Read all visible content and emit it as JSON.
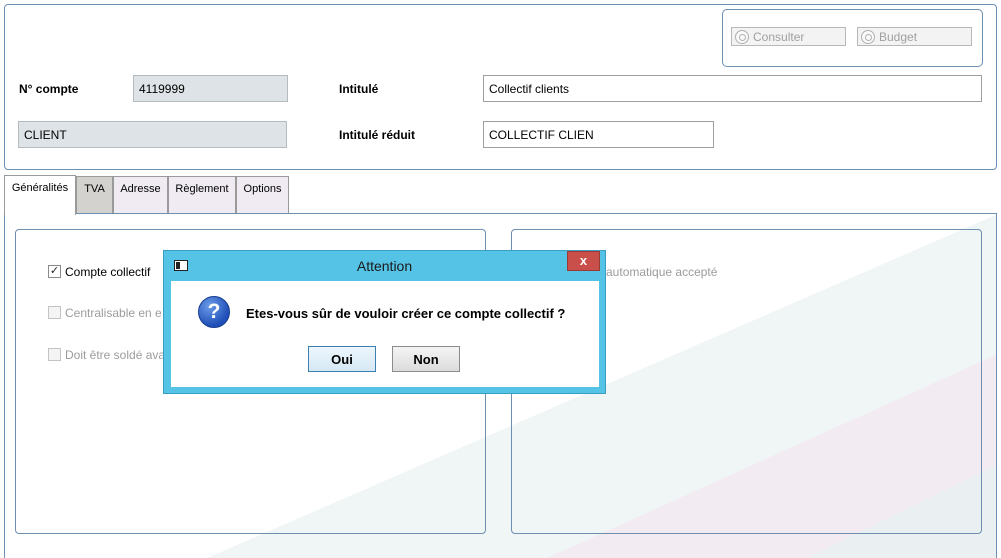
{
  "toolbar": {
    "consulter_label": "Consulter",
    "budget_label": "Budget"
  },
  "header": {
    "account_number_label": "N° compte",
    "account_number_value": "4119999",
    "type_value": "CLIENT",
    "title_label": "Intitulé",
    "title_value": "Collectif clients",
    "short_title_label": "Intitulé réduit",
    "short_title_value": "COLLECTIF CLIEN"
  },
  "tabs": [
    {
      "label": "Généralités",
      "accel": "G"
    },
    {
      "label": "TVA",
      "accel": "T"
    },
    {
      "label": "Adresse",
      "accel": "A"
    },
    {
      "label": "Règlement",
      "accel": "R"
    },
    {
      "label": "Options",
      "accel": "O"
    }
  ],
  "general": {
    "compte_collectif": {
      "label": "Compte collectif",
      "checked": true
    },
    "centralisable": {
      "label": "Centralisable en e",
      "checked": false
    },
    "doit_etre_solde": {
      "label": "Doit être soldé ava",
      "checked": false
    },
    "right_option_label": "e automatique accepté"
  },
  "dialog": {
    "title": "Attention",
    "close_label": "x",
    "message": "Etes-vous sûr de vouloir créer ce compte collectif ?",
    "icon": "question-icon",
    "yes_label": "Oui",
    "no_label": "Non"
  },
  "colors": {
    "panel_border": "#6d8fb4",
    "readonly_field": "#dde3e6",
    "dialog_frame": "#55c3e6",
    "close_button": "#c9504a"
  }
}
